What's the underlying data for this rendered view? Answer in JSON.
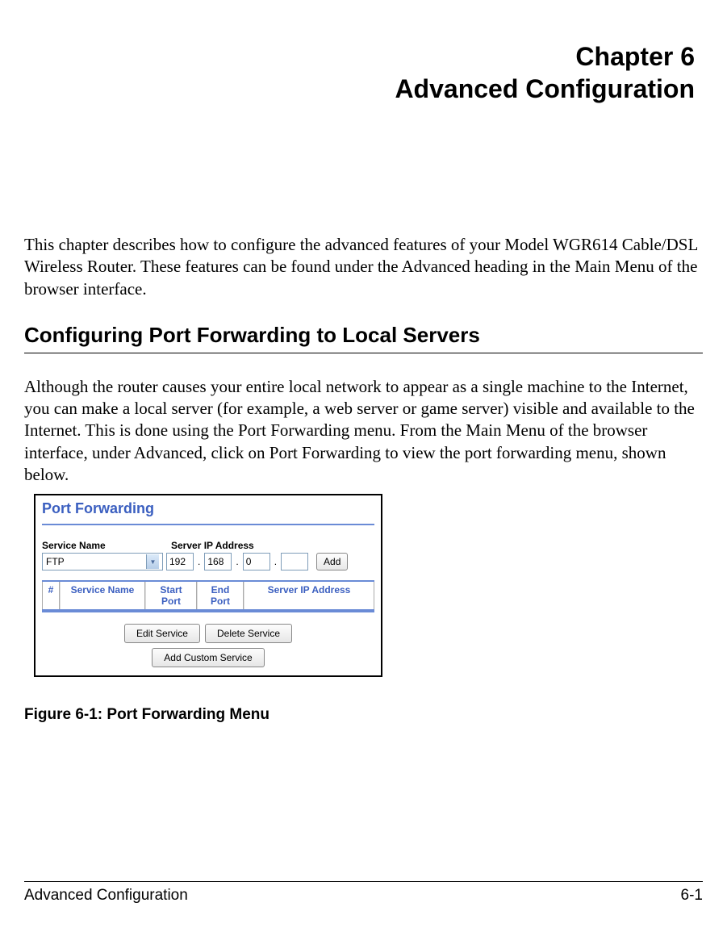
{
  "chapter": {
    "label": "Chapter 6",
    "title": "Advanced Configuration"
  },
  "intro": "This chapter describes how to configure the advanced features of your Model WGR614 Cable/DSL Wireless Router. These features can be found under the Advanced heading in the Main Menu of the browser interface.",
  "section": {
    "heading": "Configuring Port Forwarding to Local Servers",
    "body": "Although the router causes your entire local network to appear as a single machine to the Internet, you can make a local server (for example, a web server or game server) visible and available to the Internet. This is done using the Port Forwarding menu. From the Main Menu of the browser interface, under Advanced, click on Port Forwarding to view the port forwarding menu, shown below."
  },
  "port_forwarding": {
    "title": "Port Forwarding",
    "labels": {
      "service_name": "Service Name",
      "server_ip": "Server IP Address"
    },
    "service_select": "FTP",
    "ip": [
      "192",
      "168",
      "0",
      ""
    ],
    "add_label": "Add",
    "table": {
      "headers": {
        "num": "#",
        "service": "Service Name",
        "start": "Start Port",
        "end": "End Port",
        "ip": "Server IP Address"
      }
    },
    "buttons": {
      "edit": "Edit Service",
      "delete": "Delete Service",
      "custom": "Add Custom Service"
    }
  },
  "figure_caption": "Figure 6-1: Port Forwarding Menu",
  "footer": {
    "left": "Advanced Configuration",
    "right": "6-1"
  }
}
